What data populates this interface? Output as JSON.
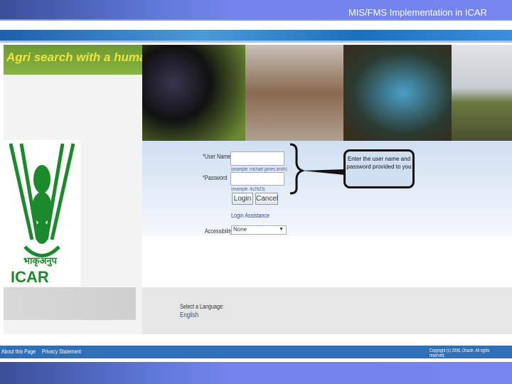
{
  "header": {
    "title": "MIS/FMS Implementation in ICAR"
  },
  "banner": {
    "tagline": "Agri search with a human touch"
  },
  "logo": {
    "hindi": "भाकृअनुप",
    "name": "ICAR"
  },
  "login": {
    "username_label": "*User Name",
    "username_value": "",
    "username_hint": "(example: michael.james.smith)",
    "password_label": "*Password",
    "password_value": "",
    "password_hint": "(example: 4u2N23)",
    "login_button": "Login",
    "cancel_button": "Cancel",
    "assistance_link": "Login Assistance",
    "accessibility_label": "Accessibility",
    "accessibility_value": "None"
  },
  "callout": {
    "text": "Enter the user name and password provided to you"
  },
  "language": {
    "label": "Select a Language:",
    "option": "English"
  },
  "footer": {
    "about": "About this Page",
    "privacy": "Privacy Statement",
    "copyright": "Copyright (c) 2006, Oracle. All rights reserved."
  }
}
